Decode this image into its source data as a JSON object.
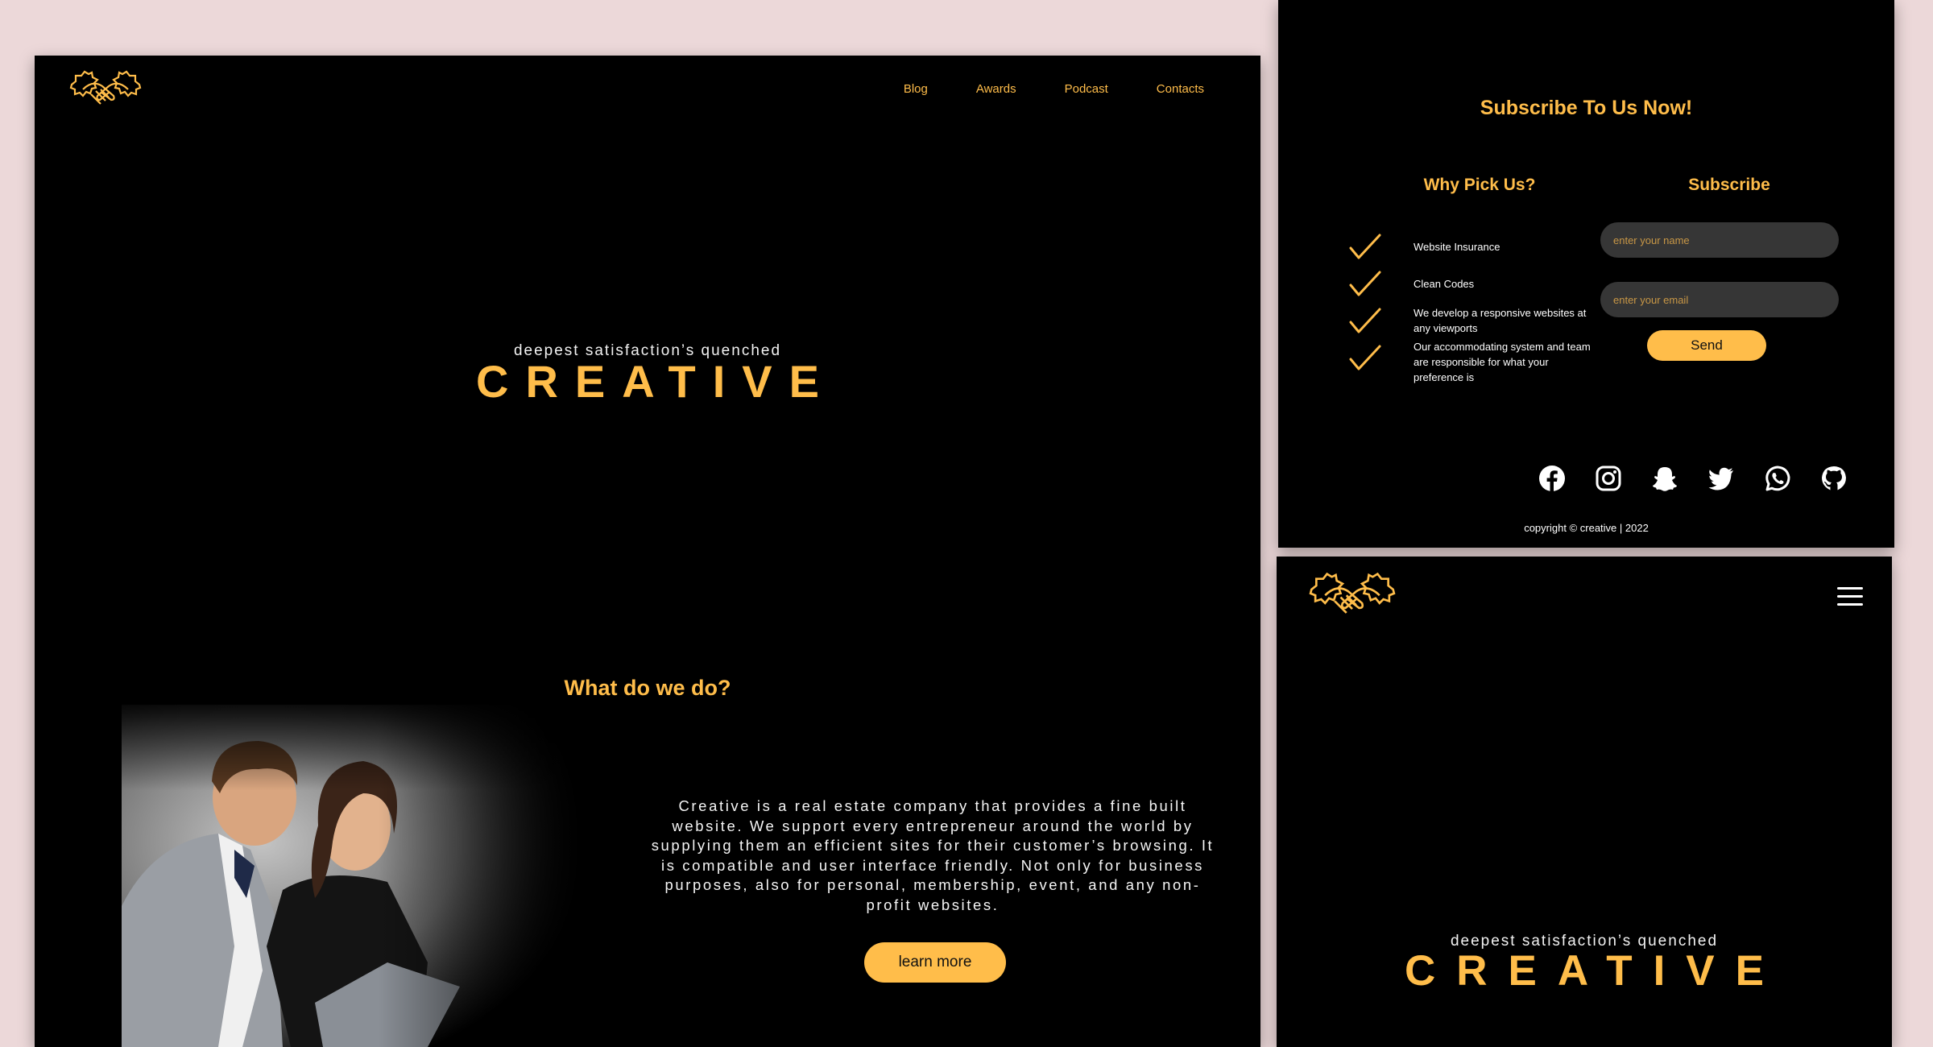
{
  "colors": {
    "accent": "#ffbd4a",
    "panel_bg": "#000000",
    "page_bg": "#ecd8d9",
    "field_bg": "#363636"
  },
  "desktop": {
    "logo_icon": "handshake-gear-icon",
    "nav": [
      "Blog",
      "Awards",
      "Podcast",
      "Contacts"
    ],
    "hero": {
      "subtitle": "deepest satisfaction’s quenched",
      "title": "CREATIVE"
    },
    "what": {
      "title": "What do we do?",
      "text": "Creative is a real estate company that provides a fine built website. We support every entrepreneur around the world by supplying them an efficient sites for their customer’s browsing. It is compatible and user interface friendly. Not only for business purposes, also for personal, membership, event, and any non-profit websites.",
      "button": "learn more"
    }
  },
  "footer": {
    "title": "Subscribe To Us Now!",
    "why": {
      "title": "Why Pick Us?",
      "items": [
        "Website Insurance",
        "Clean Codes",
        "We develop a responsive websites at any viewports",
        "Our accommodating system and team are responsible for what your preference is"
      ]
    },
    "subscribe": {
      "title": "Subscribe",
      "name_placeholder": "enter your name",
      "email_placeholder": "enter your email",
      "button": "Send"
    },
    "socials": [
      "facebook-icon",
      "instagram-icon",
      "snapchat-icon",
      "twitter-icon",
      "whatsapp-icon",
      "github-icon"
    ],
    "copyright": "copyright © creative | 2022"
  },
  "mobile": {
    "logo_icon": "handshake-gear-icon",
    "menu_icon": "hamburger-menu-icon",
    "hero": {
      "subtitle": "deepest satisfaction’s quenched",
      "title": "CREATIVE"
    }
  }
}
